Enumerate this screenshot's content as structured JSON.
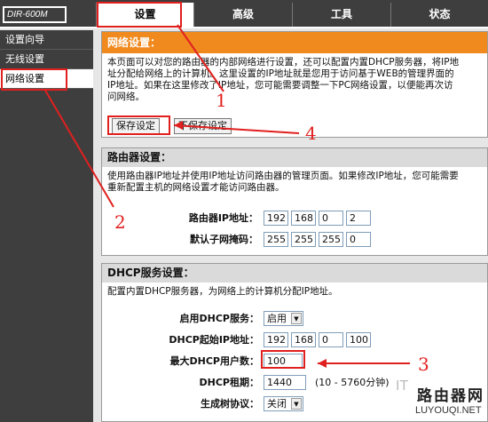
{
  "header": {
    "model": "DIR-600M",
    "tabs": [
      {
        "label": "设置"
      },
      {
        "label": "高级"
      },
      {
        "label": "工具"
      },
      {
        "label": "状态"
      }
    ]
  },
  "sidebar": {
    "items": [
      {
        "label": "设置向导"
      },
      {
        "label": "无线设置"
      },
      {
        "label": "网络设置"
      }
    ]
  },
  "network": {
    "title": "网络设置：",
    "desc": [
      "本页面可以对您的路由器的内部网络进行设置，还可以配置内置DHCP服务器，将IP地",
      "址分配给网络上的计算机。这里设置的IP地址就是您用于访问基于WEB的管理界面的",
      "IP地址。如果在这里修改了IP地址，您可能需要调整一下PC网络设置，以便能再次访",
      "问网络。"
    ],
    "save_label": "保存设定",
    "nosave_label": "不保存设定"
  },
  "router": {
    "title": "路由器设置：",
    "desc": [
      "使用路由器IP地址并使用IP地址访问路由器的管理页面。如果修改IP地址，您可能需要",
      "重新配置主机的网络设置才能访问路由器。"
    ],
    "ip_label": "路由器IP地址：",
    "ip": [
      "192",
      "168",
      "0",
      "2"
    ],
    "mask_label": "默认子网掩码：",
    "mask": [
      "255",
      "255",
      "255",
      "0"
    ]
  },
  "dhcp": {
    "title": "DHCP服务设置：",
    "desc": "配置内置DHCP服务器，为网络上的计算机分配IP地址。",
    "enable_label": "启用DHCP服务：",
    "enable_value": "启用",
    "start_label": "DHCP起始IP地址：",
    "start_ip": [
      "192",
      "168",
      "0",
      "100"
    ],
    "max_label": "最大DHCP用户数：",
    "max_value": "100",
    "lease_label": "DHCP租期：",
    "lease_value": "1440",
    "lease_note": "(10 - 5760分钟)",
    "stp_label": "生成树协议：",
    "stp_value": "关闭"
  },
  "annotations": {
    "one": "1",
    "two": "2",
    "three": "3",
    "four": "4",
    "color": "#e0201e"
  },
  "watermark": {
    "it": "IT",
    "cn": "路由器网",
    "en": "LUYOUQI.NET"
  }
}
